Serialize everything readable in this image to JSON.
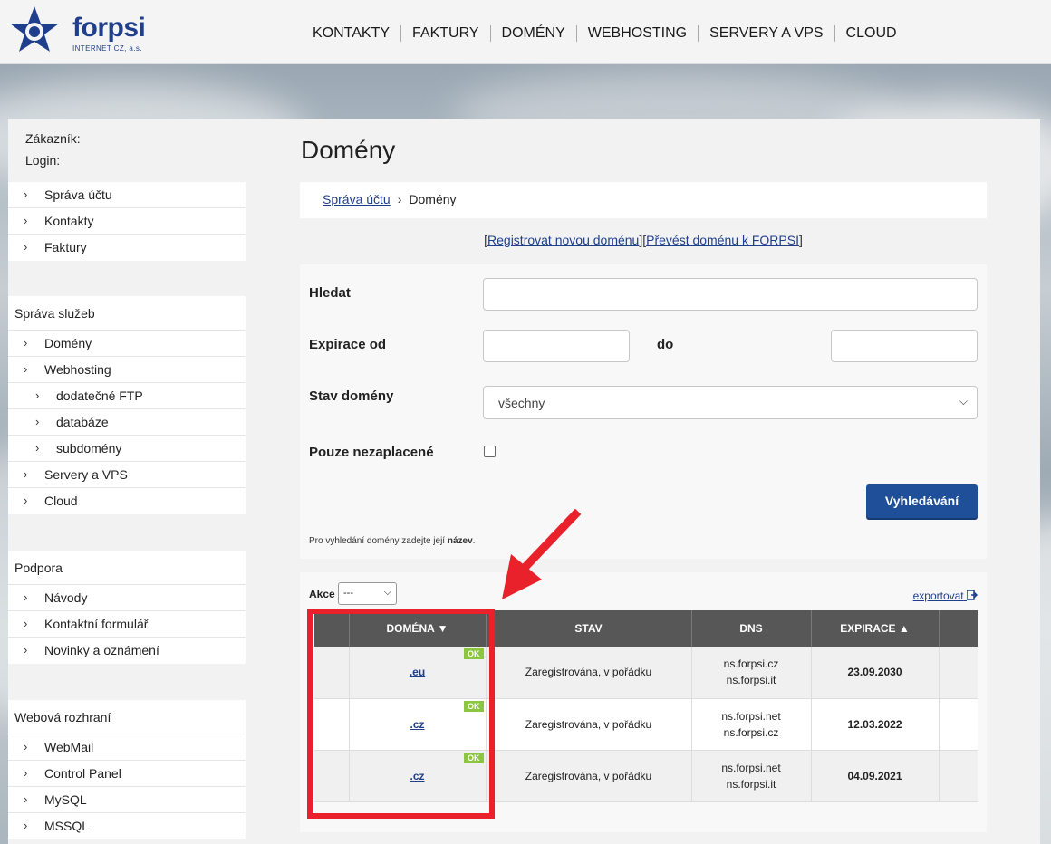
{
  "brand": {
    "name": "forpsi",
    "subtitle": "INTERNET CZ, a.s.",
    "color": "#1f3f8c"
  },
  "nav": [
    "KONTAKTY",
    "FAKTURY",
    "DOMÉNY",
    "WEBHOSTING",
    "SERVERY A VPS",
    "CLOUD"
  ],
  "account": {
    "customer_label": "Zákazník:",
    "login_label": "Login:"
  },
  "sidebar": {
    "account_items": [
      "Správa účtu",
      "Kontakty",
      "Faktury"
    ],
    "services": {
      "title": "Správa služeb",
      "items": [
        "Domény",
        "Webhosting",
        "dodatečné FTP",
        "databáze",
        "subdomény",
        "Servery a VPS",
        "Cloud"
      ]
    },
    "support": {
      "title": "Podpora",
      "items": [
        "Návody",
        "Kontaktní formulář",
        "Novinky a oznámení"
      ]
    },
    "web": {
      "title": "Webová rozhraní",
      "items": [
        "WebMail",
        "Control Panel",
        "MySQL",
        "MSSQL"
      ]
    }
  },
  "page": {
    "title": "Domény",
    "breadcrumb": {
      "parent": "Správa účtu",
      "current": "Domény"
    },
    "links": {
      "register": "Registrovat novou doménu",
      "transfer": "Převést doménu k FORPSI"
    }
  },
  "form": {
    "search_label": "Hledat",
    "search_value": "",
    "expiry_from_label": "Expirace od",
    "expiry_to_label": "do",
    "status_label": "Stav domény",
    "status_value": "všechny",
    "unpaid_label": "Pouze nezaplacené",
    "unpaid_checked": false,
    "search_button": "Vyhledávání",
    "hint_prefix": "Pro vyhledání domény zadejte její",
    "hint_bold": "název",
    "hint_suffix": "."
  },
  "results": {
    "action_label": "Akce",
    "action_value": "---",
    "export_label": "exportovat",
    "columns": [
      "DOMÉNA",
      "STAV",
      "DNS",
      "EXPIRACE"
    ],
    "sort": {
      "domena": "desc",
      "expirace": "asc"
    },
    "rows": [
      {
        "domain": ".eu",
        "badge": "OK",
        "status": "Zaregistrována, v pořádku",
        "dns1": "ns.forpsi.cz",
        "dns2": "ns.forpsi.it",
        "expiry": "23.09.2030"
      },
      {
        "domain": ".cz",
        "badge": "OK",
        "status": "Zaregistrována, v pořádku",
        "dns1": "ns.forpsi.net",
        "dns2": "ns.forpsi.cz",
        "expiry": "12.03.2022"
      },
      {
        "domain": ".cz",
        "badge": "OK",
        "status": "Zaregistrována, v pořádku",
        "dns1": "ns.forpsi.net",
        "dns2": "ns.forpsi.it",
        "expiry": "04.09.2021"
      }
    ]
  },
  "annotation_color": "#e8212a",
  "ok_color": "#8cc63e",
  "button_color": "#1f4f99"
}
